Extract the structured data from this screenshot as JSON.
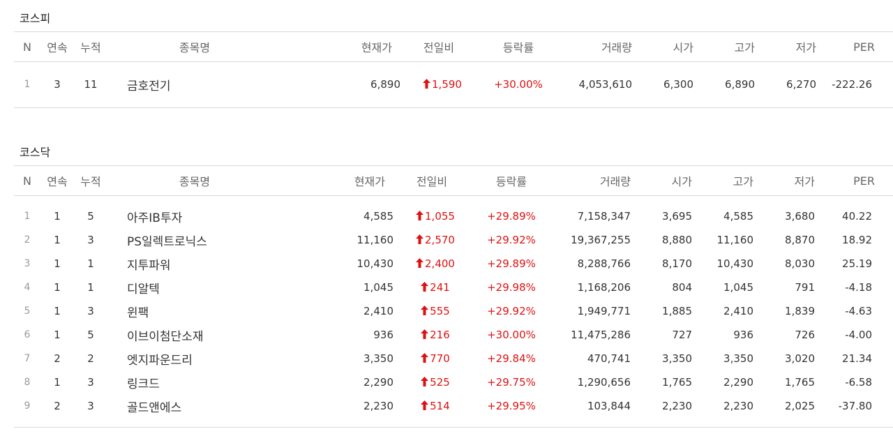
{
  "columns": [
    "N",
    "연속",
    "누적",
    "종목명",
    "현재가",
    "전일비",
    "등락률",
    "거래량",
    "시가",
    "고가",
    "저가",
    "PER"
  ],
  "icons": {
    "up": "up-arrow-icon"
  },
  "colors": {
    "up": "#dd1111"
  },
  "kospi": {
    "title": "코스피",
    "rows": [
      {
        "n": "1",
        "streak": "3",
        "total": "11",
        "name": "금호전기",
        "price": "6,890",
        "change": "1,590",
        "rate": "+30.00%",
        "volume": "4,053,610",
        "open": "6,300",
        "high": "6,890",
        "low": "6,270",
        "per": "-222.26"
      }
    ]
  },
  "kosdaq": {
    "title": "코스닥",
    "rows": [
      {
        "n": "1",
        "streak": "1",
        "total": "5",
        "name": "아주IB투자",
        "price": "4,585",
        "change": "1,055",
        "rate": "+29.89%",
        "volume": "7,158,347",
        "open": "3,695",
        "high": "4,585",
        "low": "3,680",
        "per": "40.22"
      },
      {
        "n": "2",
        "streak": "1",
        "total": "3",
        "name": "PS일렉트로닉스",
        "price": "11,160",
        "change": "2,570",
        "rate": "+29.92%",
        "volume": "19,367,255",
        "open": "8,880",
        "high": "11,160",
        "low": "8,870",
        "per": "18.92"
      },
      {
        "n": "3",
        "streak": "1",
        "total": "1",
        "name": "지투파워",
        "price": "10,430",
        "change": "2,400",
        "rate": "+29.89%",
        "volume": "8,288,766",
        "open": "8,170",
        "high": "10,430",
        "low": "8,030",
        "per": "25.19"
      },
      {
        "n": "4",
        "streak": "1",
        "total": "1",
        "name": "디알텍",
        "price": "1,045",
        "change": "241",
        "rate": "+29.98%",
        "volume": "1,168,206",
        "open": "804",
        "high": "1,045",
        "low": "791",
        "per": "-4.18"
      },
      {
        "n": "5",
        "streak": "1",
        "total": "3",
        "name": "윈팩",
        "price": "2,410",
        "change": "555",
        "rate": "+29.92%",
        "volume": "1,949,771",
        "open": "1,885",
        "high": "2,410",
        "low": "1,839",
        "per": "-4.63"
      },
      {
        "n": "6",
        "streak": "1",
        "total": "5",
        "name": "이브이첨단소재",
        "price": "936",
        "change": "216",
        "rate": "+30.00%",
        "volume": "11,475,286",
        "open": "727",
        "high": "936",
        "low": "726",
        "per": "-4.00"
      },
      {
        "n": "7",
        "streak": "2",
        "total": "2",
        "name": "엣지파운드리",
        "price": "3,350",
        "change": "770",
        "rate": "+29.84%",
        "volume": "470,741",
        "open": "3,350",
        "high": "3,350",
        "low": "3,020",
        "per": "21.34"
      },
      {
        "n": "8",
        "streak": "1",
        "total": "3",
        "name": "링크드",
        "price": "2,290",
        "change": "525",
        "rate": "+29.75%",
        "volume": "1,290,656",
        "open": "1,765",
        "high": "2,290",
        "low": "1,765",
        "per": "-6.58"
      },
      {
        "n": "9",
        "streak": "2",
        "total": "3",
        "name": "골드앤에스",
        "price": "2,230",
        "change": "514",
        "rate": "+29.95%",
        "volume": "103,844",
        "open": "2,230",
        "high": "2,230",
        "low": "2,025",
        "per": "-37.80"
      }
    ]
  }
}
